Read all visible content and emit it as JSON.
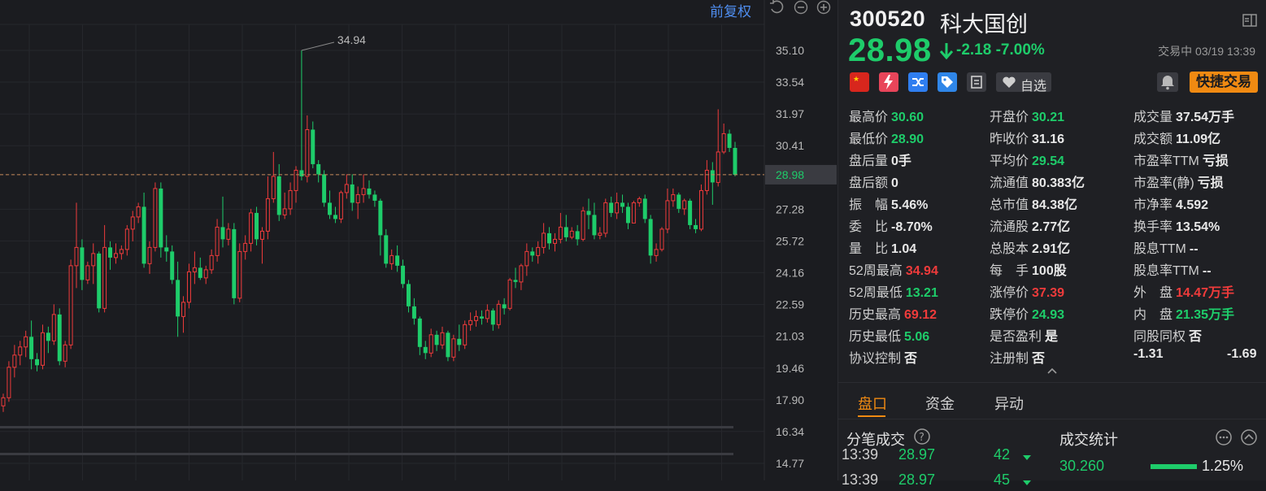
{
  "toolbar": {
    "adjust_label": "前复权"
  },
  "chart_data": {
    "type": "candlestick",
    "y_ticks": [
      "35.10",
      "33.54",
      "31.97",
      "30.41",
      "28.98",
      "27.28",
      "25.72",
      "24.16",
      "22.59",
      "21.03",
      "19.46",
      "17.90",
      "16.34",
      "14.77"
    ],
    "ylim": [
      14.77,
      35.1
    ],
    "current_price": "28.98",
    "high_marker": "34.94",
    "up_color": "#ef3b3b",
    "down_color": "#1ecc6a",
    "candles": [
      [
        17.6,
        18.2,
        17.3,
        18.0
      ],
      [
        18.0,
        19.8,
        17.8,
        19.5
      ],
      [
        19.5,
        20.6,
        19.0,
        20.1
      ],
      [
        20.1,
        20.8,
        19.6,
        20.5
      ],
      [
        20.5,
        21.3,
        20.0,
        21.0
      ],
      [
        21.0,
        21.8,
        19.4,
        19.9
      ],
      [
        19.9,
        20.2,
        19.3,
        19.6
      ],
      [
        19.6,
        21.6,
        19.4,
        21.2
      ],
      [
        21.2,
        21.5,
        20.2,
        20.8
      ],
      [
        20.8,
        22.6,
        20.6,
        22.1
      ],
      [
        22.1,
        22.4,
        19.6,
        19.8
      ],
      [
        19.8,
        20.8,
        19.5,
        20.6
      ],
      [
        20.6,
        24.8,
        20.4,
        24.5
      ],
      [
        24.5,
        27.6,
        23.4,
        25.4
      ],
      [
        25.4,
        25.8,
        23.3,
        23.8
      ],
      [
        23.8,
        24.7,
        23.6,
        24.5
      ],
      [
        24.5,
        25.6,
        23.6,
        25.1
      ],
      [
        25.1,
        25.2,
        22.2,
        22.4
      ],
      [
        22.4,
        26.5,
        22.2,
        25.4
      ],
      [
        25.4,
        25.7,
        24.3,
        24.9
      ],
      [
        24.9,
        25.6,
        24.6,
        25.1
      ],
      [
        25.1,
        25.5,
        24.8,
        25.3
      ],
      [
        25.3,
        26.5,
        25.0,
        26.3
      ],
      [
        26.3,
        27.2,
        25.7,
        26.9
      ],
      [
        26.9,
        27.6,
        26.6,
        27.4
      ],
      [
        27.4,
        28.1,
        24.4,
        24.6
      ],
      [
        24.6,
        25.7,
        24.1,
        25.4
      ],
      [
        25.4,
        28.6,
        25.2,
        28.3
      ],
      [
        28.3,
        28.6,
        24.9,
        25.4
      ],
      [
        25.4,
        26.0,
        24.7,
        25.2
      ],
      [
        25.2,
        25.5,
        23.6,
        23.8
      ],
      [
        23.8,
        24.7,
        21.0,
        22.0
      ],
      [
        22.0,
        23.0,
        21.2,
        22.7
      ],
      [
        22.7,
        24.6,
        22.4,
        24.2
      ],
      [
        24.2,
        25.2,
        23.6,
        24.4
      ],
      [
        24.4,
        24.9,
        23.8,
        23.9
      ],
      [
        23.9,
        24.5,
        23.6,
        24.3
      ],
      [
        24.3,
        25.3,
        24.1,
        25.0
      ],
      [
        25.0,
        26.8,
        24.7,
        26.4
      ],
      [
        26.4,
        27.9,
        25.4,
        25.8
      ],
      [
        25.8,
        26.6,
        25.5,
        26.3
      ],
      [
        26.3,
        26.6,
        22.6,
        22.9
      ],
      [
        22.9,
        25.6,
        22.7,
        25.2
      ],
      [
        25.2,
        26.0,
        24.8,
        25.6
      ],
      [
        25.6,
        27.3,
        25.2,
        27.1
      ],
      [
        27.1,
        27.4,
        25.5,
        25.8
      ],
      [
        25.8,
        26.4,
        24.6,
        26.2
      ],
      [
        26.2,
        28.9,
        25.8,
        27.8
      ],
      [
        27.8,
        30.1,
        27.6,
        28.9
      ],
      [
        28.9,
        29.5,
        26.7,
        27.0
      ],
      [
        27.0,
        28.1,
        26.8,
        27.3
      ],
      [
        27.3,
        28.6,
        27.0,
        28.2
      ],
      [
        28.2,
        29.4,
        27.6,
        29.2
      ],
      [
        29.2,
        35.1,
        28.7,
        28.9
      ],
      [
        28.9,
        31.9,
        28.6,
        31.2
      ],
      [
        31.2,
        31.6,
        29.3,
        29.5
      ],
      [
        29.5,
        29.7,
        28.6,
        29.0
      ],
      [
        29.0,
        29.2,
        27.4,
        27.6
      ],
      [
        27.6,
        28.2,
        26.8,
        27.0
      ],
      [
        27.0,
        27.4,
        26.6,
        26.8
      ],
      [
        26.8,
        28.2,
        26.6,
        28.1
      ],
      [
        28.1,
        29.0,
        27.8,
        28.5
      ],
      [
        28.5,
        29.0,
        27.2,
        27.6
      ],
      [
        27.6,
        28.4,
        26.8,
        28.0
      ],
      [
        28.0,
        29.0,
        27.6,
        28.3
      ],
      [
        28.3,
        28.7,
        27.8,
        28.0
      ],
      [
        28.0,
        28.2,
        27.4,
        27.7
      ],
      [
        27.7,
        27.8,
        25.0,
        26.0
      ],
      [
        26.0,
        26.3,
        24.4,
        24.6
      ],
      [
        24.6,
        25.3,
        24.3,
        25.0
      ],
      [
        25.0,
        25.5,
        24.2,
        24.5
      ],
      [
        24.5,
        24.8,
        23.4,
        23.6
      ],
      [
        23.6,
        23.8,
        22.2,
        22.5
      ],
      [
        22.5,
        22.9,
        21.6,
        21.9
      ],
      [
        21.9,
        22.0,
        20.1,
        20.5
      ],
      [
        20.5,
        20.8,
        19.9,
        20.2
      ],
      [
        20.2,
        21.4,
        20.0,
        21.1
      ],
      [
        21.1,
        21.3,
        20.3,
        20.6
      ],
      [
        20.6,
        21.5,
        20.4,
        21.2
      ],
      [
        21.2,
        21.3,
        19.8,
        20.0
      ],
      [
        20.0,
        21.1,
        19.8,
        20.9
      ],
      [
        20.9,
        21.6,
        20.3,
        20.6
      ],
      [
        20.6,
        21.8,
        20.4,
        21.6
      ],
      [
        21.6,
        22.2,
        21.3,
        21.8
      ],
      [
        21.8,
        22.3,
        21.5,
        22.0
      ],
      [
        22.0,
        22.3,
        21.6,
        21.9
      ],
      [
        21.9,
        22.6,
        21.7,
        22.3
      ],
      [
        22.3,
        22.4,
        21.3,
        21.6
      ],
      [
        21.6,
        22.8,
        21.4,
        22.6
      ],
      [
        22.6,
        22.9,
        22.1,
        22.4
      ],
      [
        22.4,
        23.9,
        22.3,
        23.8
      ],
      [
        23.8,
        24.4,
        23.4,
        23.7
      ],
      [
        23.7,
        24.6,
        23.3,
        24.5
      ],
      [
        24.5,
        25.6,
        24.0,
        25.2
      ],
      [
        25.2,
        25.4,
        24.7,
        25.0
      ],
      [
        25.0,
        25.7,
        24.6,
        25.4
      ],
      [
        25.4,
        26.6,
        25.1,
        26.1
      ],
      [
        26.1,
        26.4,
        25.3,
        25.6
      ],
      [
        25.6,
        26.1,
        25.2,
        25.8
      ],
      [
        25.8,
        27.1,
        25.6,
        26.4
      ],
      [
        26.4,
        27.0,
        25.7,
        25.9
      ],
      [
        25.9,
        26.4,
        25.8,
        26.2
      ],
      [
        26.2,
        26.5,
        25.5,
        25.8
      ],
      [
        25.8,
        27.4,
        25.7,
        27.2
      ],
      [
        27.2,
        27.8,
        26.3,
        27.0
      ],
      [
        27.0,
        27.6,
        25.8,
        26.0
      ],
      [
        26.0,
        26.4,
        25.8,
        26.1
      ],
      [
        26.1,
        27.8,
        25.9,
        27.6
      ],
      [
        27.6,
        27.9,
        26.9,
        27.1
      ],
      [
        27.1,
        28.1,
        26.8,
        27.6
      ],
      [
        27.6,
        28.0,
        27.1,
        27.4
      ],
      [
        27.4,
        27.6,
        26.3,
        26.6
      ],
      [
        26.6,
        27.7,
        26.6,
        27.6
      ],
      [
        27.6,
        27.9,
        27.4,
        27.8
      ],
      [
        27.8,
        28.0,
        26.6,
        26.8
      ],
      [
        26.8,
        27.0,
        24.6,
        25.0
      ],
      [
        25.0,
        25.6,
        24.7,
        25.3
      ],
      [
        25.3,
        26.4,
        25.2,
        26.3
      ],
      [
        26.3,
        28.3,
        26.1,
        27.7
      ],
      [
        27.7,
        28.3,
        27.4,
        28.0
      ],
      [
        28.0,
        28.1,
        27.1,
        27.3
      ],
      [
        27.3,
        27.8,
        27.0,
        27.7
      ],
      [
        27.7,
        27.8,
        26.3,
        26.5
      ],
      [
        26.5,
        26.8,
        26.1,
        26.3
      ],
      [
        26.3,
        28.5,
        26.2,
        28.2
      ],
      [
        28.2,
        29.7,
        28.0,
        29.2
      ],
      [
        29.2,
        29.6,
        27.5,
        28.6
      ],
      [
        28.6,
        32.2,
        28.4,
        30.1
      ],
      [
        30.1,
        31.5,
        30.0,
        31.0
      ],
      [
        31.0,
        31.2,
        30.1,
        30.3
      ],
      [
        30.3,
        30.6,
        28.9,
        28.98
      ]
    ]
  },
  "quote": {
    "code": "300520",
    "name": "科大国创",
    "price": "28.98",
    "change": "-2.18 -7.00%",
    "status": "交易中 03/19 13:39",
    "watch_label": "自选",
    "quick_trade_label": "快捷交易"
  },
  "stats": [
    [
      {
        "label": "最高价",
        "value": "30.60",
        "color": "g"
      },
      {
        "label": "开盘价",
        "value": "30.21",
        "color": "g"
      },
      {
        "label": "成交量",
        "value": "37.54万手",
        "color": "w"
      }
    ],
    [
      {
        "label": "最低价",
        "value": "28.90",
        "color": "g"
      },
      {
        "label": "昨收价",
        "value": "31.16",
        "color": "w"
      },
      {
        "label": "成交额",
        "value": "11.09亿",
        "color": "w"
      }
    ],
    [
      {
        "label": "盘后量",
        "value": "0手",
        "color": "w"
      },
      {
        "label": "平均价",
        "value": "29.54",
        "color": "g"
      },
      {
        "label": "市盈率TTM",
        "value": "亏损",
        "color": "w"
      }
    ],
    [
      {
        "label": "盘后额",
        "value": "0",
        "color": "w"
      },
      {
        "label": "流通值",
        "value": "80.383亿",
        "color": "w"
      },
      {
        "label": "市盈率(静)",
        "value": "亏损",
        "color": "w"
      }
    ],
    [
      {
        "label": "振　幅",
        "value": "5.46%",
        "color": "w"
      },
      {
        "label": "总市值",
        "value": "84.38亿",
        "color": "w"
      },
      {
        "label": "市净率",
        "value": "4.592",
        "color": "w"
      }
    ],
    [
      {
        "label": "委　比",
        "value": "-8.70%",
        "color": "w"
      },
      {
        "label": "流通股",
        "value": "2.77亿",
        "color": "w"
      },
      {
        "label": "换手率",
        "value": "13.54%",
        "color": "w"
      }
    ],
    [
      {
        "label": "量　比",
        "value": "1.04",
        "color": "w"
      },
      {
        "label": "总股本",
        "value": "2.91亿",
        "color": "w"
      },
      {
        "label": "股息TTM",
        "value": "--",
        "color": "w"
      }
    ],
    [
      {
        "label": "52周最高",
        "value": "34.94",
        "color": "r"
      },
      {
        "label": "每　手",
        "value": "100股",
        "color": "w"
      },
      {
        "label": "股息率TTM",
        "value": "--",
        "color": "w"
      }
    ],
    [
      {
        "label": "52周最低",
        "value": "13.21",
        "color": "g"
      },
      {
        "label": "涨停价",
        "value": "37.39",
        "color": "r"
      },
      {
        "label": "外　盘",
        "value": "14.47万手",
        "color": "r"
      }
    ],
    [
      {
        "label": "历史最高",
        "value": "69.12",
        "color": "r"
      },
      {
        "label": "跌停价",
        "value": "24.93",
        "color": "g"
      },
      {
        "label": "内　盘",
        "value": "21.35万手",
        "color": "g"
      }
    ],
    [
      {
        "label": "历史最低",
        "value": "5.06",
        "color": "g"
      },
      {
        "label": "是否盈利",
        "value": "是",
        "color": "w"
      },
      {
        "label": "同股同权",
        "value": "否",
        "color": "w"
      }
    ],
    [
      {
        "label": "协议控制",
        "value": "否",
        "color": "w"
      },
      {
        "label": "注册制",
        "value": "否",
        "color": "w"
      },
      {
        "label": "",
        "value": "-1.31",
        "color": "w",
        "extra": "-1.69"
      }
    ]
  ],
  "tabs": [
    "盘口",
    "资金",
    "异动"
  ],
  "trades_title": "分笔成交",
  "trades": [
    {
      "time": "13:39",
      "price": "28.97",
      "vol": "42"
    },
    {
      "time": "13:39",
      "price": "28.97",
      "vol": "45"
    }
  ],
  "stats_title": "成交统计",
  "deal_stat": {
    "price": "30.260",
    "pct": "1.25%"
  }
}
